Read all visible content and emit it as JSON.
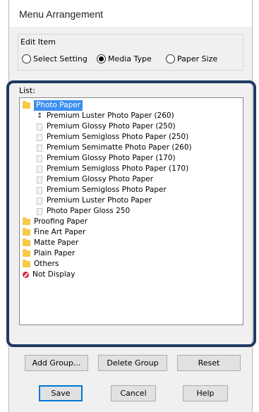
{
  "window": {
    "title": "Menu Arrangement"
  },
  "edit_item": {
    "label": "Edit Item",
    "options": [
      {
        "label": "Select Setting",
        "checked": false
      },
      {
        "label": "Media Type",
        "checked": true
      },
      {
        "label": "Paper Size",
        "checked": false
      }
    ]
  },
  "list": {
    "label": "List:",
    "items": [
      {
        "label": "Photo Paper",
        "type": "folder",
        "selected": true
      },
      {
        "label": "Premium Luster Photo Paper (260)",
        "type": "doc-cursor"
      },
      {
        "label": "Premium Glossy Photo Paper (250)",
        "type": "doc"
      },
      {
        "label": "Premium Semigloss Photo Paper (250)",
        "type": "doc"
      },
      {
        "label": "Premium Semimatte Photo Paper (260)",
        "type": "doc"
      },
      {
        "label": "Premium Glossy Photo Paper (170)",
        "type": "doc"
      },
      {
        "label": "Premium Semigloss Photo Paper (170)",
        "type": "doc"
      },
      {
        "label": "Premium Glossy Photo Paper",
        "type": "doc"
      },
      {
        "label": "Premium Semigloss Photo Paper",
        "type": "doc"
      },
      {
        "label": "Premium Luster Photo Paper",
        "type": "doc"
      },
      {
        "label": "Photo Paper Gloss 250",
        "type": "doc"
      },
      {
        "label": "Proofing Paper",
        "type": "folder"
      },
      {
        "label": "Fine Art Paper",
        "type": "folder"
      },
      {
        "label": "Matte Paper",
        "type": "folder"
      },
      {
        "label": "Plain Paper",
        "type": "folder"
      },
      {
        "label": "Others",
        "type": "folder"
      },
      {
        "label": "Not Display",
        "type": "nodisplay"
      }
    ]
  },
  "buttons": {
    "add_group": "Add Group...",
    "delete_group": "Delete Group",
    "reset": "Reset",
    "save": "Save",
    "cancel": "Cancel",
    "help": "Help"
  },
  "colors": {
    "highlight_frame": "#1f3a60",
    "selection": "#3c8ff0",
    "folder": "#f7c948",
    "not_display": "#d7263d"
  }
}
